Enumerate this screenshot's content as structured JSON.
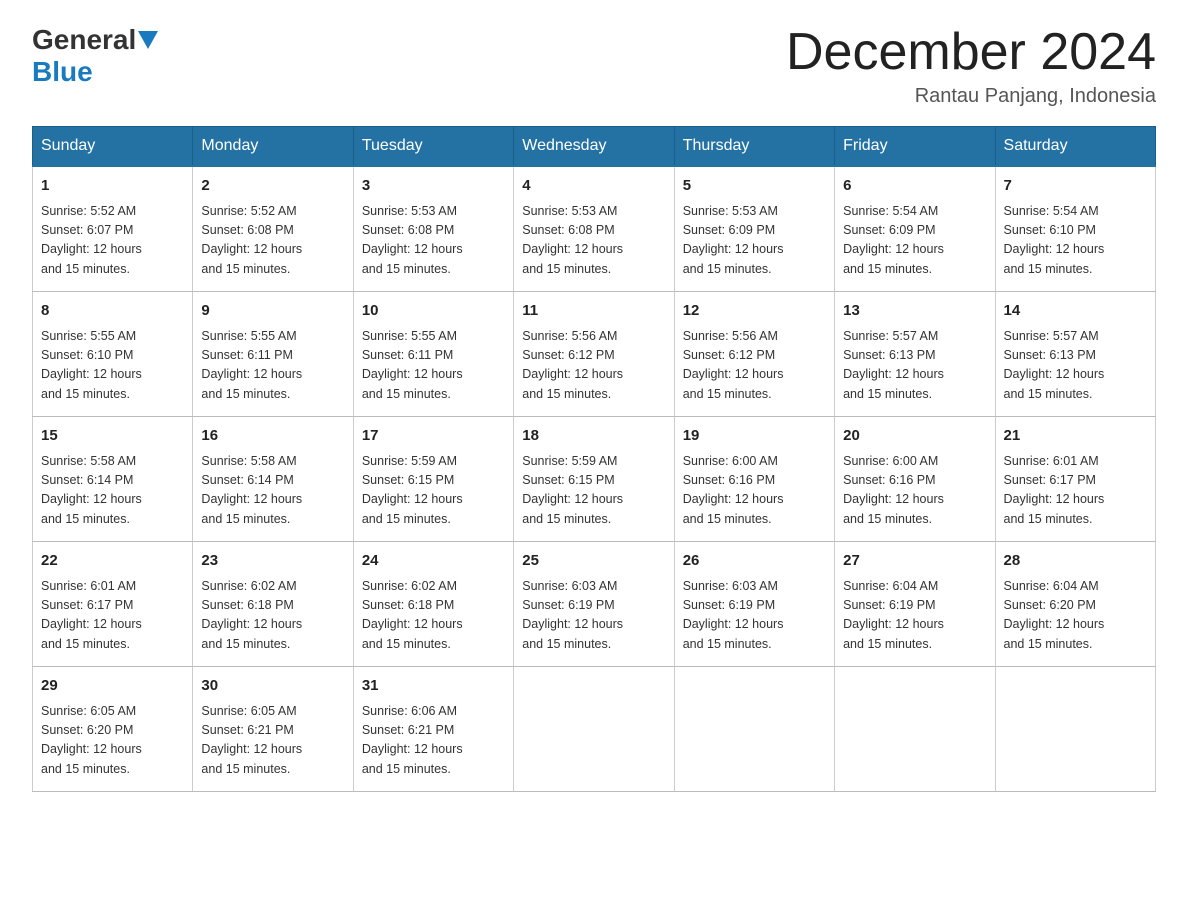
{
  "header": {
    "logo": {
      "general": "General",
      "blue": "Blue"
    },
    "title": "December 2024",
    "location": "Rantau Panjang, Indonesia"
  },
  "days_of_week": [
    "Sunday",
    "Monday",
    "Tuesday",
    "Wednesday",
    "Thursday",
    "Friday",
    "Saturday"
  ],
  "weeks": [
    [
      {
        "day": "1",
        "sunrise": "5:52 AM",
        "sunset": "6:07 PM",
        "daylight": "12 hours and 15 minutes."
      },
      {
        "day": "2",
        "sunrise": "5:52 AM",
        "sunset": "6:08 PM",
        "daylight": "12 hours and 15 minutes."
      },
      {
        "day": "3",
        "sunrise": "5:53 AM",
        "sunset": "6:08 PM",
        "daylight": "12 hours and 15 minutes."
      },
      {
        "day": "4",
        "sunrise": "5:53 AM",
        "sunset": "6:08 PM",
        "daylight": "12 hours and 15 minutes."
      },
      {
        "day": "5",
        "sunrise": "5:53 AM",
        "sunset": "6:09 PM",
        "daylight": "12 hours and 15 minutes."
      },
      {
        "day": "6",
        "sunrise": "5:54 AM",
        "sunset": "6:09 PM",
        "daylight": "12 hours and 15 minutes."
      },
      {
        "day": "7",
        "sunrise": "5:54 AM",
        "sunset": "6:10 PM",
        "daylight": "12 hours and 15 minutes."
      }
    ],
    [
      {
        "day": "8",
        "sunrise": "5:55 AM",
        "sunset": "6:10 PM",
        "daylight": "12 hours and 15 minutes."
      },
      {
        "day": "9",
        "sunrise": "5:55 AM",
        "sunset": "6:11 PM",
        "daylight": "12 hours and 15 minutes."
      },
      {
        "day": "10",
        "sunrise": "5:55 AM",
        "sunset": "6:11 PM",
        "daylight": "12 hours and 15 minutes."
      },
      {
        "day": "11",
        "sunrise": "5:56 AM",
        "sunset": "6:12 PM",
        "daylight": "12 hours and 15 minutes."
      },
      {
        "day": "12",
        "sunrise": "5:56 AM",
        "sunset": "6:12 PM",
        "daylight": "12 hours and 15 minutes."
      },
      {
        "day": "13",
        "sunrise": "5:57 AM",
        "sunset": "6:13 PM",
        "daylight": "12 hours and 15 minutes."
      },
      {
        "day": "14",
        "sunrise": "5:57 AM",
        "sunset": "6:13 PM",
        "daylight": "12 hours and 15 minutes."
      }
    ],
    [
      {
        "day": "15",
        "sunrise": "5:58 AM",
        "sunset": "6:14 PM",
        "daylight": "12 hours and 15 minutes."
      },
      {
        "day": "16",
        "sunrise": "5:58 AM",
        "sunset": "6:14 PM",
        "daylight": "12 hours and 15 minutes."
      },
      {
        "day": "17",
        "sunrise": "5:59 AM",
        "sunset": "6:15 PM",
        "daylight": "12 hours and 15 minutes."
      },
      {
        "day": "18",
        "sunrise": "5:59 AM",
        "sunset": "6:15 PM",
        "daylight": "12 hours and 15 minutes."
      },
      {
        "day": "19",
        "sunrise": "6:00 AM",
        "sunset": "6:16 PM",
        "daylight": "12 hours and 15 minutes."
      },
      {
        "day": "20",
        "sunrise": "6:00 AM",
        "sunset": "6:16 PM",
        "daylight": "12 hours and 15 minutes."
      },
      {
        "day": "21",
        "sunrise": "6:01 AM",
        "sunset": "6:17 PM",
        "daylight": "12 hours and 15 minutes."
      }
    ],
    [
      {
        "day": "22",
        "sunrise": "6:01 AM",
        "sunset": "6:17 PM",
        "daylight": "12 hours and 15 minutes."
      },
      {
        "day": "23",
        "sunrise": "6:02 AM",
        "sunset": "6:18 PM",
        "daylight": "12 hours and 15 minutes."
      },
      {
        "day": "24",
        "sunrise": "6:02 AM",
        "sunset": "6:18 PM",
        "daylight": "12 hours and 15 minutes."
      },
      {
        "day": "25",
        "sunrise": "6:03 AM",
        "sunset": "6:19 PM",
        "daylight": "12 hours and 15 minutes."
      },
      {
        "day": "26",
        "sunrise": "6:03 AM",
        "sunset": "6:19 PM",
        "daylight": "12 hours and 15 minutes."
      },
      {
        "day": "27",
        "sunrise": "6:04 AM",
        "sunset": "6:19 PM",
        "daylight": "12 hours and 15 minutes."
      },
      {
        "day": "28",
        "sunrise": "6:04 AM",
        "sunset": "6:20 PM",
        "daylight": "12 hours and 15 minutes."
      }
    ],
    [
      {
        "day": "29",
        "sunrise": "6:05 AM",
        "sunset": "6:20 PM",
        "daylight": "12 hours and 15 minutes."
      },
      {
        "day": "30",
        "sunrise": "6:05 AM",
        "sunset": "6:21 PM",
        "daylight": "12 hours and 15 minutes."
      },
      {
        "day": "31",
        "sunrise": "6:06 AM",
        "sunset": "6:21 PM",
        "daylight": "12 hours and 15 minutes."
      },
      null,
      null,
      null,
      null
    ]
  ],
  "labels": {
    "sunrise": "Sunrise:",
    "sunset": "Sunset:",
    "daylight": "Daylight:"
  }
}
